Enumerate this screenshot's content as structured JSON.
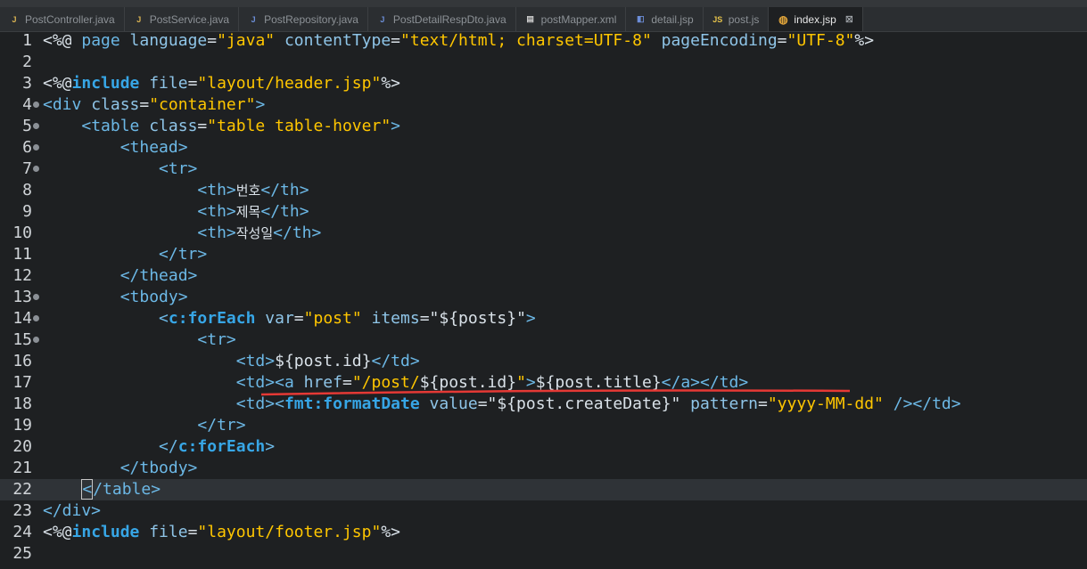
{
  "tabs": [
    {
      "label": "PostController.java",
      "icon": "java-file-icon",
      "active": false
    },
    {
      "label": "PostService.java",
      "icon": "java-file-icon",
      "active": false
    },
    {
      "label": "PostRepository.java",
      "icon": "java-interface-icon",
      "active": false
    },
    {
      "label": "PostDetailRespDto.java",
      "icon": "java-interface-icon",
      "active": false
    },
    {
      "label": "postMapper.xml",
      "icon": "xml-file-icon",
      "active": false
    },
    {
      "label": "detail.jsp",
      "icon": "jsp-file-icon",
      "active": false
    },
    {
      "label": "post.js",
      "icon": "js-file-icon",
      "active": false
    },
    {
      "label": "index.jsp",
      "icon": "jsp-globe-icon",
      "active": true
    }
  ],
  "close_glyph": "⊠",
  "editor": {
    "current_line": 22,
    "line_numbers": [
      "1",
      "2",
      "3",
      "4",
      "5",
      "6",
      "7",
      "8",
      "9",
      "10",
      "11",
      "12",
      "13",
      "14",
      "15",
      "16",
      "17",
      "18",
      "19",
      "20",
      "21",
      "22",
      "23",
      "24",
      "25"
    ],
    "lines": [
      [
        {
          "t": "<%@ ",
          "c": "plain"
        },
        {
          "t": "page ",
          "c": "tag"
        },
        {
          "t": "language",
          "c": "attr"
        },
        {
          "t": "=",
          "c": "plain"
        },
        {
          "t": "\"java\"",
          "c": "str"
        },
        {
          "t": " contentType",
          "c": "attr"
        },
        {
          "t": "=",
          "c": "plain"
        },
        {
          "t": "\"text/html; charset=UTF-8\"",
          "c": "str"
        },
        {
          "t": " pageEncoding",
          "c": "attr"
        },
        {
          "t": "=",
          "c": "plain"
        },
        {
          "t": "\"UTF-8\"",
          "c": "str"
        },
        {
          "t": "%>",
          "c": "plain"
        }
      ],
      [],
      [
        {
          "t": "<%@",
          "c": "plain"
        },
        {
          "t": "include",
          "c": "tagbold"
        },
        {
          "t": " file",
          "c": "attr"
        },
        {
          "t": "=",
          "c": "plain"
        },
        {
          "t": "\"layout/header.jsp\"",
          "c": "str"
        },
        {
          "t": "%>",
          "c": "plain"
        }
      ],
      [
        {
          "t": "<div ",
          "c": "tag"
        },
        {
          "t": "class",
          "c": "attr"
        },
        {
          "t": "=",
          "c": "plain"
        },
        {
          "t": "\"container\"",
          "c": "str"
        },
        {
          "t": ">",
          "c": "tag"
        }
      ],
      [
        {
          "t": "    ",
          "c": "plain"
        },
        {
          "t": "<table ",
          "c": "tag"
        },
        {
          "t": "class",
          "c": "attr"
        },
        {
          "t": "=",
          "c": "plain"
        },
        {
          "t": "\"table table-hover\"",
          "c": "str"
        },
        {
          "t": ">",
          "c": "tag"
        }
      ],
      [
        {
          "t": "        ",
          "c": "plain"
        },
        {
          "t": "<thead>",
          "c": "tag"
        }
      ],
      [
        {
          "t": "            ",
          "c": "plain"
        },
        {
          "t": "<tr>",
          "c": "tag"
        }
      ],
      [
        {
          "t": "                ",
          "c": "plain"
        },
        {
          "t": "<th>",
          "c": "tag"
        },
        {
          "t": "번호",
          "c": "ko"
        },
        {
          "t": "</th>",
          "c": "tag"
        }
      ],
      [
        {
          "t": "                ",
          "c": "plain"
        },
        {
          "t": "<th>",
          "c": "tag"
        },
        {
          "t": "제목",
          "c": "ko"
        },
        {
          "t": "</th>",
          "c": "tag"
        }
      ],
      [
        {
          "t": "                ",
          "c": "plain"
        },
        {
          "t": "<th>",
          "c": "tag"
        },
        {
          "t": "작성일",
          "c": "ko"
        },
        {
          "t": "</th>",
          "c": "tag"
        }
      ],
      [
        {
          "t": "            ",
          "c": "plain"
        },
        {
          "t": "</tr>",
          "c": "tag"
        }
      ],
      [
        {
          "t": "        ",
          "c": "plain"
        },
        {
          "t": "</thead>",
          "c": "tag"
        }
      ],
      [
        {
          "t": "        ",
          "c": "plain"
        },
        {
          "t": "<tbody>",
          "c": "tag"
        }
      ],
      [
        {
          "t": "            ",
          "c": "plain"
        },
        {
          "t": "<",
          "c": "tag"
        },
        {
          "t": "c:forEach",
          "c": "tagbold"
        },
        {
          "t": " var",
          "c": "attr"
        },
        {
          "t": "=",
          "c": "plain"
        },
        {
          "t": "\"post\"",
          "c": "str"
        },
        {
          "t": " items",
          "c": "attr"
        },
        {
          "t": "=",
          "c": "plain"
        },
        {
          "t": "\"${posts}\"",
          "c": "plain"
        },
        {
          "t": ">",
          "c": "tag"
        }
      ],
      [
        {
          "t": "                ",
          "c": "plain"
        },
        {
          "t": "<tr>",
          "c": "tag"
        }
      ],
      [
        {
          "t": "                    ",
          "c": "plain"
        },
        {
          "t": "<td>",
          "c": "tag"
        },
        {
          "t": "${post.id}",
          "c": "plain"
        },
        {
          "t": "</td>",
          "c": "tag"
        }
      ],
      [
        {
          "t": "                    ",
          "c": "plain"
        },
        {
          "t": "<td>",
          "c": "tag"
        },
        {
          "t": "<a ",
          "c": "tag"
        },
        {
          "t": "href",
          "c": "attr"
        },
        {
          "t": "=",
          "c": "plain"
        },
        {
          "t": "\"/post/",
          "c": "str"
        },
        {
          "t": "${post.id}",
          "c": "plain"
        },
        {
          "t": "\"",
          "c": "str"
        },
        {
          "t": ">",
          "c": "tag"
        },
        {
          "t": "${post.title}",
          "c": "plain"
        },
        {
          "t": "</a>",
          "c": "tag"
        },
        {
          "t": "</td>",
          "c": "tag"
        }
      ],
      [
        {
          "t": "                    ",
          "c": "plain"
        },
        {
          "t": "<td>",
          "c": "tag"
        },
        {
          "t": "<",
          "c": "tag"
        },
        {
          "t": "fmt:formatDate",
          "c": "tagbold"
        },
        {
          "t": " value",
          "c": "attr"
        },
        {
          "t": "=",
          "c": "plain"
        },
        {
          "t": "\"${post.createDate}\"",
          "c": "plain"
        },
        {
          "t": " pattern",
          "c": "attr"
        },
        {
          "t": "=",
          "c": "plain"
        },
        {
          "t": "\"yyyy-MM-dd\"",
          "c": "str"
        },
        {
          "t": " />",
          "c": "tag"
        },
        {
          "t": "</td>",
          "c": "tag"
        }
      ],
      [
        {
          "t": "                ",
          "c": "plain"
        },
        {
          "t": "</tr>",
          "c": "tag"
        }
      ],
      [
        {
          "t": "            ",
          "c": "plain"
        },
        {
          "t": "</",
          "c": "tag"
        },
        {
          "t": "c:forEach",
          "c": "tagbold"
        },
        {
          "t": ">",
          "c": "tag"
        }
      ],
      [
        {
          "t": "        ",
          "c": "plain"
        },
        {
          "t": "</tbody>",
          "c": "tag"
        }
      ],
      [
        {
          "t": "    ",
          "c": "plain"
        },
        {
          "t": "<",
          "c": "cursor"
        },
        {
          "t": "/table>",
          "c": "tag"
        }
      ],
      [
        {
          "t": "</div>",
          "c": "tag"
        }
      ],
      [
        {
          "t": "<%@",
          "c": "plain"
        },
        {
          "t": "include",
          "c": "tagbold"
        },
        {
          "t": " file",
          "c": "attr"
        },
        {
          "t": "=",
          "c": "plain"
        },
        {
          "t": "\"layout/footer.jsp\"",
          "c": "str"
        },
        {
          "t": "%>",
          "c": "plain"
        }
      ],
      []
    ],
    "fold_lines": [
      4,
      5,
      6,
      7,
      13,
      14,
      15
    ]
  },
  "colors": {
    "background": "#1e2022",
    "tag": "#6cb8e6",
    "string": "#ffc600",
    "annotation_underline": "#e53935"
  }
}
